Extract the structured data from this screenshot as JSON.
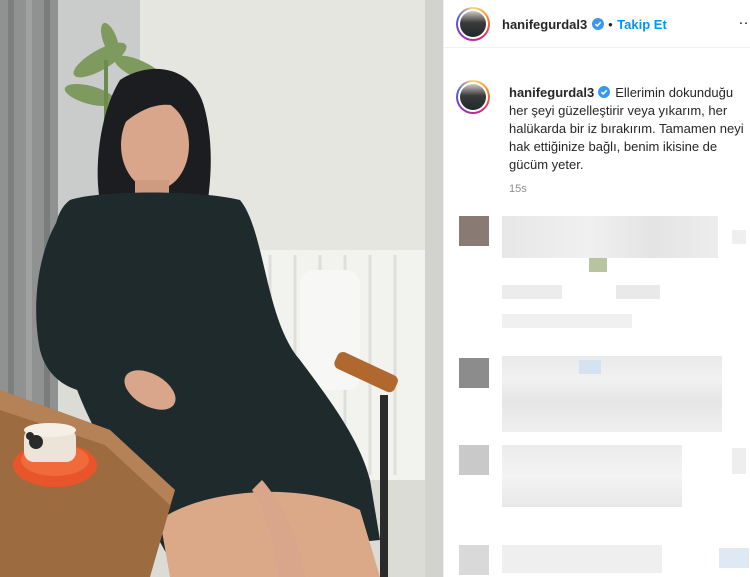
{
  "post": {
    "header": {
      "username": "hanifegurdal3",
      "separator": "•",
      "follow_label": "Takip Et",
      "more_label": "…"
    },
    "caption": {
      "username": "hanifegurdal3",
      "text": "Ellerimin dokunduğu her şeyi güzelleştirir veya yıkarım, her halükarda bir iz bırakırım. Tamamen neyi hak ettiğinize bağlı, benim ikisine de gücüm yeter.",
      "time": "15s"
    },
    "comments": {
      "state": "pixelated"
    },
    "colors": {
      "accent": "#0095f6",
      "text": "#262626",
      "muted": "#8e8e8e"
    }
  }
}
